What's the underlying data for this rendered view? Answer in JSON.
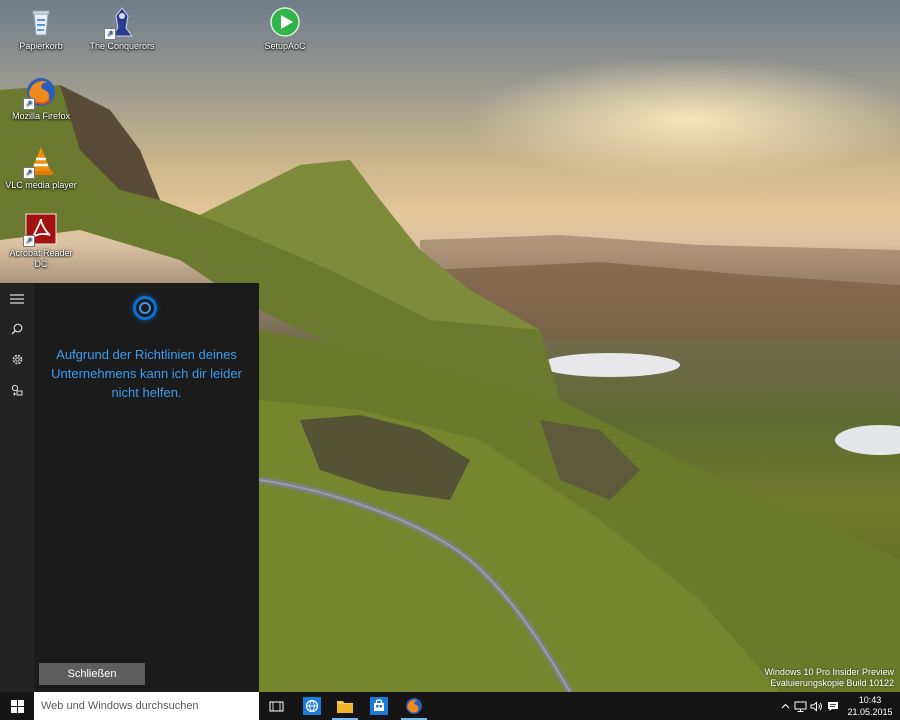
{
  "desktop": {
    "icons": [
      {
        "label": "Papierkorb",
        "icon": "recycle-bin-icon"
      },
      {
        "label": "The Conquerors",
        "icon": "conquerors-icon"
      },
      {
        "label": "SetupAoC",
        "icon": "setup-play-icon"
      },
      {
        "label": "Mozilla Firefox",
        "icon": "firefox-icon"
      },
      {
        "label": "VLC media player",
        "icon": "vlc-icon"
      },
      {
        "label": "Acrobat Reader DC",
        "icon": "acrobat-icon"
      }
    ],
    "watermark": {
      "line1": "Windows 10 Pro Insider Preview",
      "line2": "Evaluierungskopie Build 10122"
    }
  },
  "cortana": {
    "message": "Aufgrund der Richtlinien deines Unternehmens kann ich dir leider nicht helfen.",
    "close_label": "Schließen",
    "accent_color": "#0a72d6",
    "rail": [
      "hamburger-menu-icon",
      "search-icon",
      "gear-icon",
      "feedback-icon"
    ]
  },
  "taskbar": {
    "search_placeholder": "Web und Windows durchsuchen",
    "apps": [
      "task-view-icon",
      "edge-globe-icon",
      "file-explorer-icon",
      "store-icon",
      "firefox-icon"
    ],
    "tray": [
      "chevron-up-icon",
      "network-icon",
      "volume-icon",
      "action-center-icon"
    ],
    "time": "10:43",
    "date": "21.05.2015"
  }
}
